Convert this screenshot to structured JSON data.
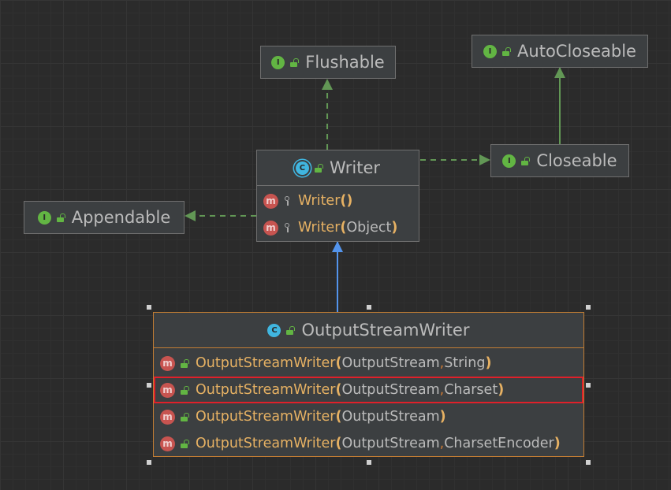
{
  "colors": {
    "background": "#2b2b2b",
    "node_fill": "#3c3f41",
    "node_border": "#6f6f6f",
    "selected_border": "#c27d34",
    "implements_arrow": "#629755",
    "extends_arrow": "#5394ec",
    "method_name": "#e6b163",
    "highlight_box": "#e0202a"
  },
  "nodes": {
    "flushable": {
      "kind_badge": "I",
      "access_icon": "lock-icon",
      "title": "Flushable"
    },
    "autocloseable": {
      "kind_badge": "I",
      "access_icon": "lock-icon",
      "title": "AutoCloseable"
    },
    "closeable": {
      "kind_badge": "I",
      "access_icon": "lock-icon",
      "title": "Closeable"
    },
    "appendable": {
      "kind_badge": "I",
      "access_icon": "lock-icon",
      "title": "Appendable"
    },
    "writer": {
      "kind_badge": "C",
      "access_icon": "lock-icon",
      "title": "Writer",
      "members": [
        {
          "badge": "m",
          "access_icon": "key-icon",
          "name": "Writer",
          "open": "(",
          "params": [],
          "close": ")"
        },
        {
          "badge": "m",
          "access_icon": "key-icon",
          "name": "Writer",
          "open": "(",
          "params": [
            "Object"
          ],
          "close": ")"
        }
      ]
    },
    "outputstreamwriter": {
      "kind_badge": "C",
      "access_icon": "lock-icon",
      "title": "OutputStreamWriter",
      "members": [
        {
          "badge": "m",
          "access_icon": "lock-icon",
          "name": "OutputStreamWriter",
          "open": "(",
          "params": [
            "OutputStream",
            "String"
          ],
          "close": ")"
        },
        {
          "badge": "m",
          "access_icon": "lock-icon",
          "name": "OutputStreamWriter",
          "open": "(",
          "params": [
            "OutputStream",
            "Charset"
          ],
          "close": ")",
          "highlighted": true
        },
        {
          "badge": "m",
          "access_icon": "lock-icon",
          "name": "OutputStreamWriter",
          "open": "(",
          "params": [
            "OutputStream"
          ],
          "close": ")"
        },
        {
          "badge": "m",
          "access_icon": "lock-icon",
          "name": "OutputStreamWriter",
          "open": "(",
          "params": [
            "OutputStream",
            "CharsetEncoder"
          ],
          "close": ")"
        }
      ]
    }
  },
  "edges": [
    {
      "from": "writer",
      "to": "flushable",
      "kind": "implements"
    },
    {
      "from": "writer",
      "to": "closeable",
      "kind": "implements"
    },
    {
      "from": "writer",
      "to": "appendable",
      "kind": "implements"
    },
    {
      "from": "closeable",
      "to": "autocloseable",
      "kind": "extends-interface"
    },
    {
      "from": "outputstreamwriter",
      "to": "writer",
      "kind": "extends"
    }
  ]
}
